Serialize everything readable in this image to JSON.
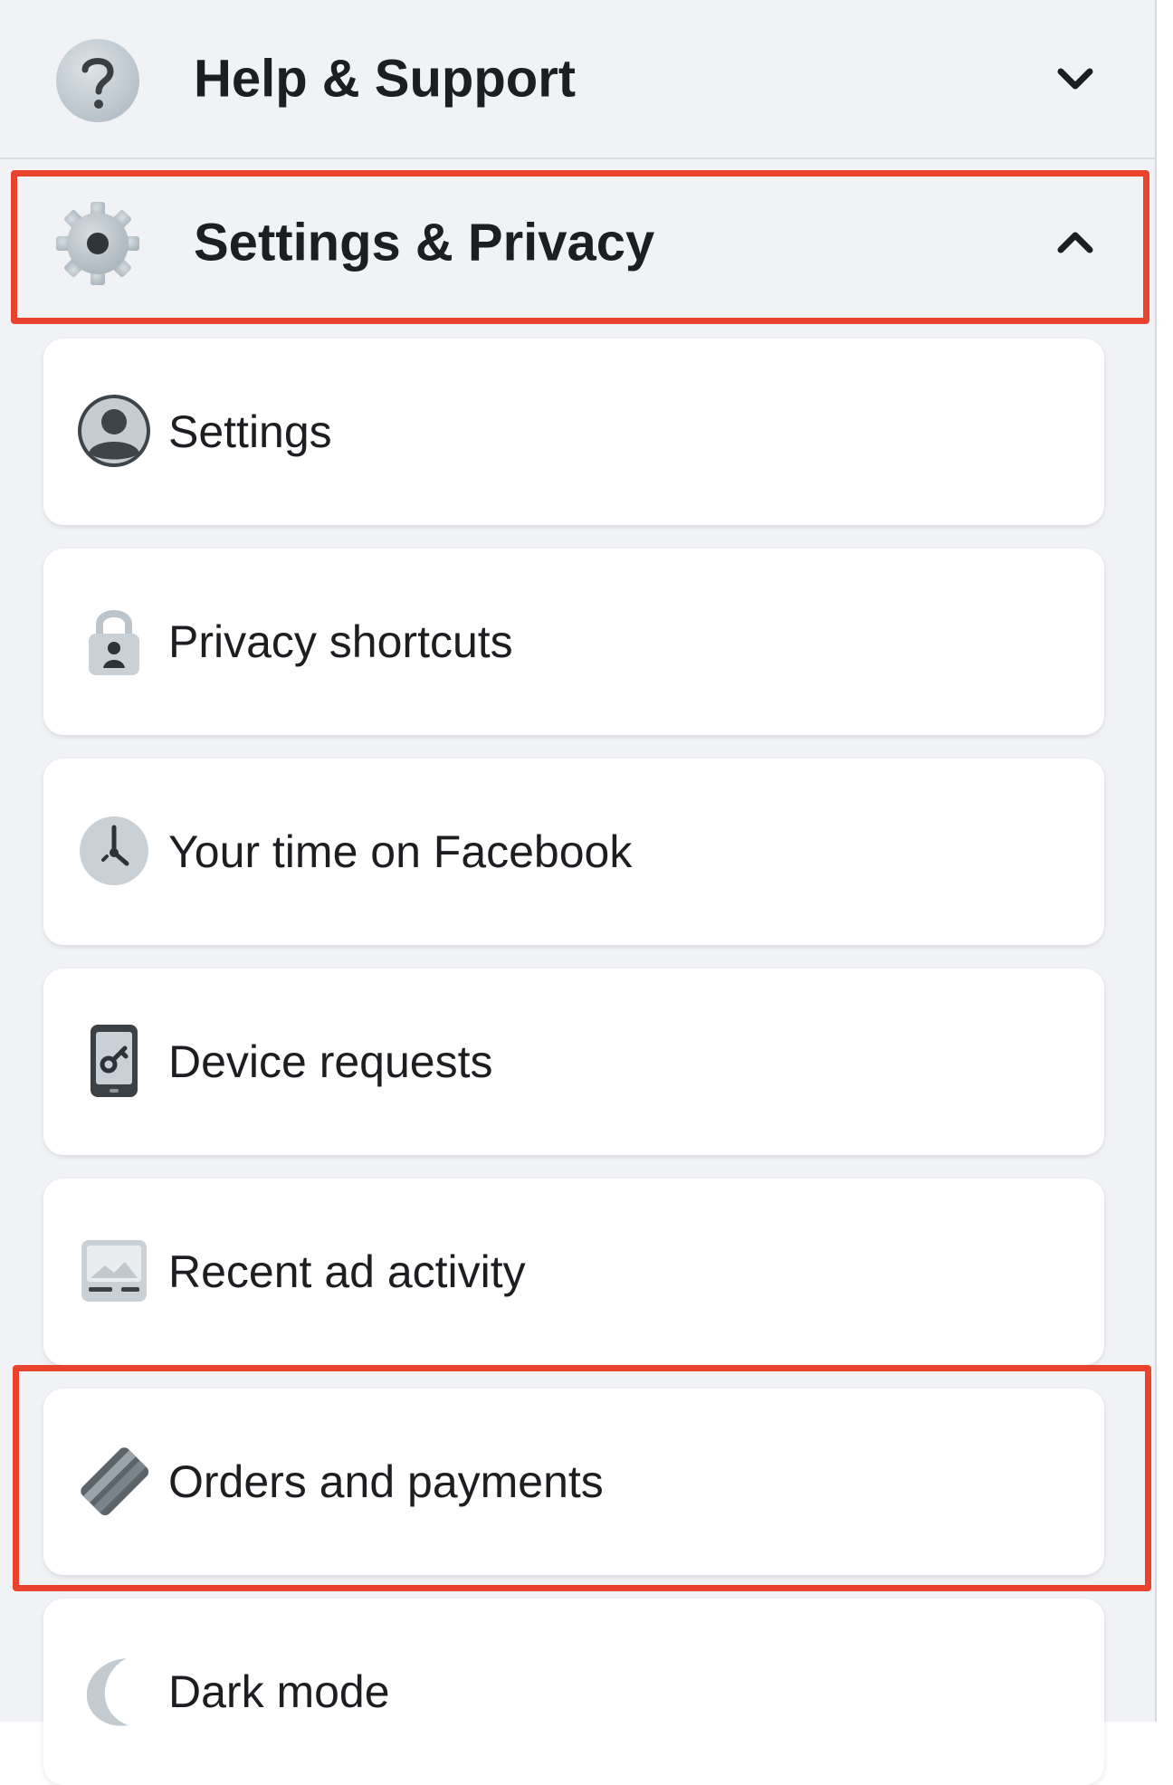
{
  "help_section": {
    "label": "Help & Support",
    "icon": "question-icon",
    "expanded": false
  },
  "settings_section": {
    "label": "Settings & Privacy",
    "icon": "gear-icon",
    "expanded": true
  },
  "menu_items": [
    {
      "label": "Settings",
      "icon": "person-icon"
    },
    {
      "label": "Privacy shortcuts",
      "icon": "lock-icon"
    },
    {
      "label": "Your time on Facebook",
      "icon": "clock-icon"
    },
    {
      "label": "Device requests",
      "icon": "phone-key-icon"
    },
    {
      "label": "Recent ad activity",
      "icon": "ad-activity-icon"
    },
    {
      "label": "Orders and payments",
      "icon": "credit-card-icon"
    },
    {
      "label": "Dark mode",
      "icon": "moon-icon"
    }
  ],
  "colors": {
    "highlight": "#e8432d",
    "panel_background": "#f0f2f5",
    "card_background": "#ffffff"
  }
}
